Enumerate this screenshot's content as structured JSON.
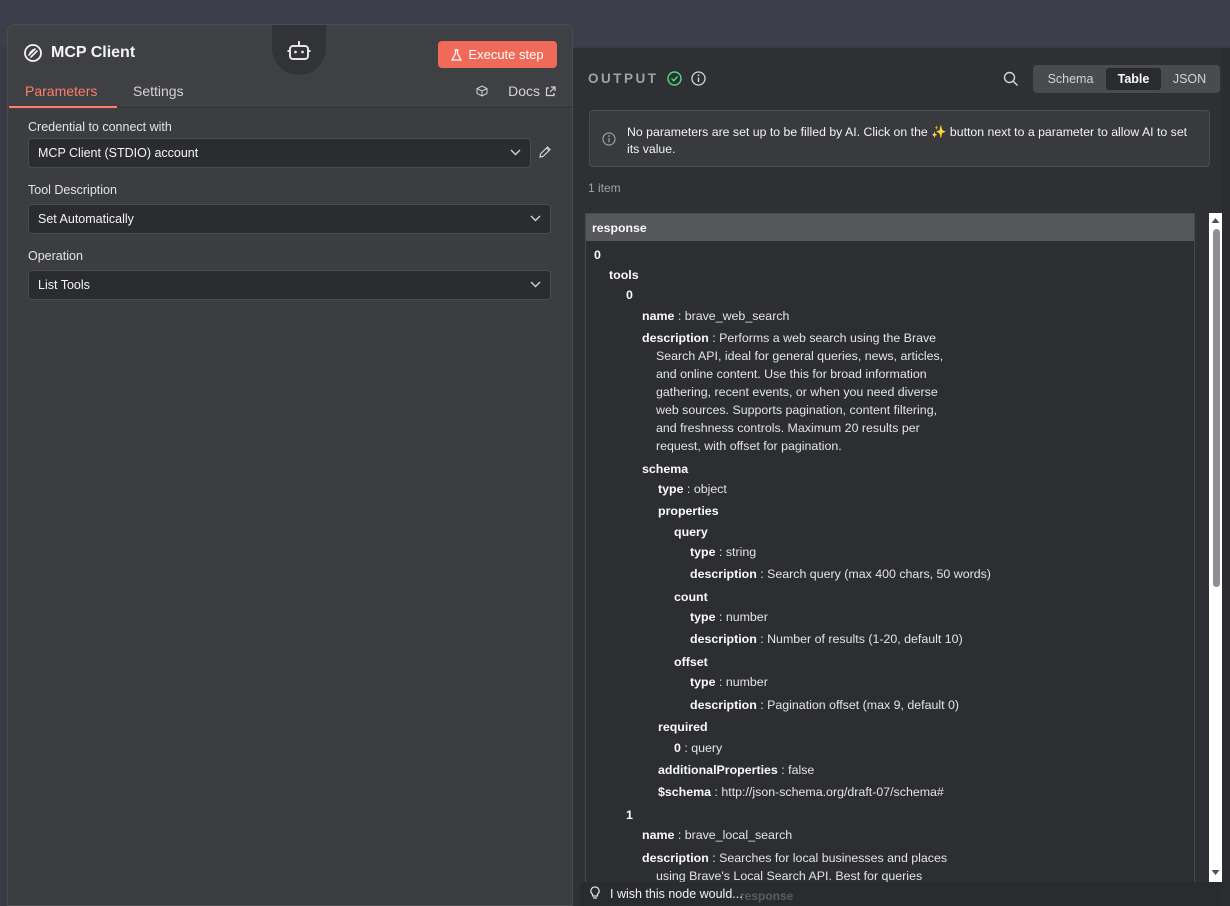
{
  "node": {
    "title": "MCP Client",
    "execute_label": "Execute step",
    "node_icon": "mcp-logo-icon",
    "robot_icon": "robot-icon"
  },
  "tabs": {
    "parameters": "Parameters",
    "settings": "Settings",
    "docs": "Docs"
  },
  "fields": {
    "credential": {
      "label": "Credential to connect with",
      "value": "MCP Client (STDIO) account"
    },
    "tool_description": {
      "label": "Tool Description",
      "value": "Set Automatically"
    },
    "operation": {
      "label": "Operation",
      "value": "List Tools"
    }
  },
  "output": {
    "label": "OUTPUT",
    "views": {
      "schema": "Schema",
      "table": "Table",
      "json": "JSON",
      "selected": "Table"
    },
    "notice": "No parameters are set up to be filled by AI. Click on the ✨ button next to a parameter to allow AI to set its value.",
    "item_count": "1 item",
    "column": "response",
    "colors": {
      "success": "#4ade80",
      "accent": "#ff7d6a",
      "execute_button": "#f06a5a"
    }
  },
  "tree": {
    "root_index": "0",
    "tools_key": "tools",
    "tool0": {
      "index": "0",
      "name_key": "name",
      "name_val": "brave_web_search",
      "desc_key": "description",
      "desc_lines": [
        "Performs a web search using the Brave",
        "Search API, ideal for general queries, news, articles,",
        "and online content. Use this for broad information",
        "gathering, recent events, or when you need diverse",
        "web sources. Supports pagination, content filtering,",
        "and freshness controls. Maximum 20 results per",
        "request, with offset for pagination."
      ],
      "schema_key": "schema",
      "type_key": "type",
      "type_val": "object",
      "properties_key": "properties",
      "query_key": "query",
      "query_type": "string",
      "query_desc": "Search query (max 400 chars, 50 words)",
      "count_key": "count",
      "count_type": "number",
      "count_desc": "Number of results (1-20, default 10)",
      "offset_key": "offset",
      "offset_type": "number",
      "offset_desc": "Pagination offset (max 9, default 0)",
      "required_key": "required",
      "required_idx": "0",
      "required_val": "query",
      "additional_key": "additionalProperties",
      "additional_val": "false",
      "schema_uri_key": "$schema",
      "schema_uri_val": "http://json-schema.org/draft-07/schema#"
    },
    "tool1": {
      "index": "1",
      "name_key": "name",
      "name_val": "brave_local_search",
      "desc_key": "description",
      "desc_lines": [
        "Searches for local businesses and places",
        "using Brave's Local Search API. Best for queries"
      ]
    },
    "type_key": "type",
    "description_key": "description"
  },
  "feedback": {
    "text": "I wish this node would...",
    "ghost": "response"
  }
}
